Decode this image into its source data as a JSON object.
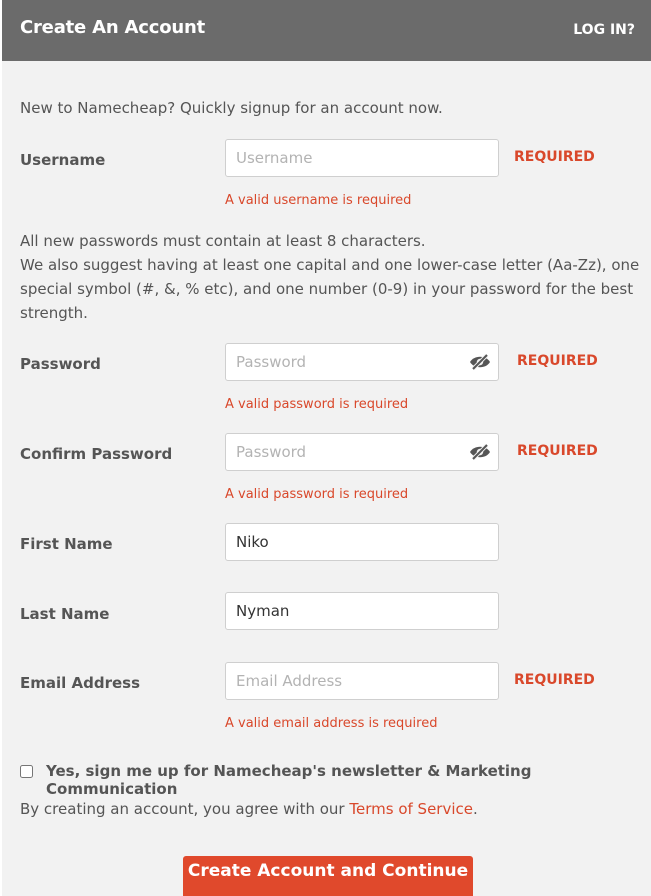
{
  "header": {
    "title": "Create An Account",
    "login_link": "LOG IN?"
  },
  "intro": "New to Namecheap? Quickly signup for an account now.",
  "required_label": "REQUIRED",
  "password_hint": {
    "line1": "All new passwords must contain at least 8 characters.",
    "line2": "We also suggest having at least one capital and one lower-case letter (Aa-Zz), one",
    "line3": "special symbol (#, &, % etc), and one number (0-9) in your password for the best",
    "line4": "strength."
  },
  "fields": {
    "username": {
      "label": "Username",
      "placeholder": "Username",
      "value": "",
      "error": "A valid username is required"
    },
    "password": {
      "label": "Password",
      "placeholder": "Password",
      "value": "",
      "error": "A valid password is required"
    },
    "confirm_password": {
      "label": "Confirm Password",
      "placeholder": "Password",
      "value": "",
      "error": "A valid password is required"
    },
    "first_name": {
      "label": "First Name",
      "placeholder": "",
      "value": "Niko"
    },
    "last_name": {
      "label": "Last Name",
      "placeholder": "",
      "value": "Nyman"
    },
    "email": {
      "label": "Email Address",
      "placeholder": "Email Address",
      "value": "",
      "error": "A valid email address is required"
    }
  },
  "newsletter": {
    "label": "Yes, sign me up for Namecheap's newsletter & Marketing Communication",
    "checked": false
  },
  "terms": {
    "prefix": "By creating an account, you agree with our ",
    "link": "Terms of Service",
    "suffix": "."
  },
  "submit_label": "Create Account and Continue",
  "icons": {
    "password_toggle": "eye-slash-icon"
  },
  "colors": {
    "header_bg": "#6b6b6b",
    "accent": "#e0492c",
    "error": "#d9482b"
  }
}
